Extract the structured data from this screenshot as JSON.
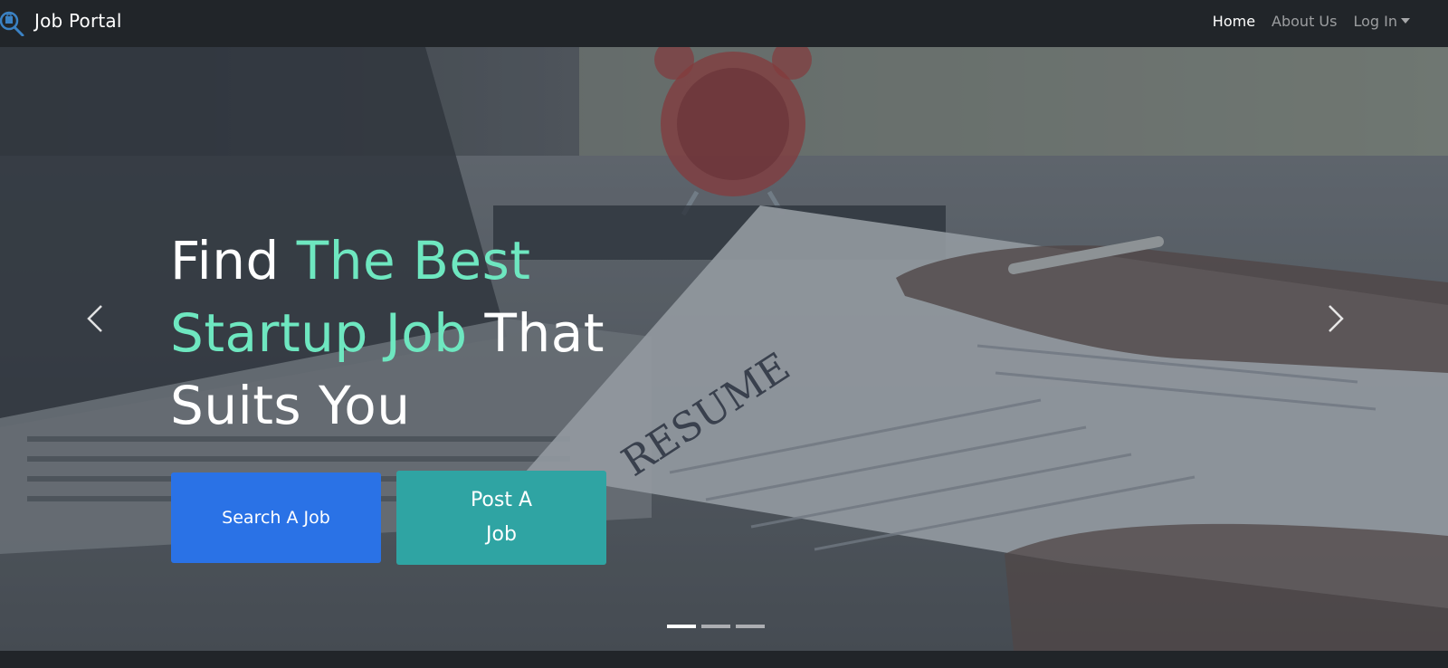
{
  "navbar": {
    "brand": "Job Portal",
    "brand_icon": "job-search-logo-icon",
    "links": [
      {
        "label": "Home",
        "active": true
      },
      {
        "label": "About Us",
        "active": false
      },
      {
        "label": "Log In",
        "active": false,
        "dropdown": true
      }
    ]
  },
  "hero": {
    "headline": {
      "part1": "Find ",
      "accent1": "The Best",
      "accent2": "Startup Job",
      "part2": " That",
      "part3": "Suits You"
    },
    "buttons": {
      "search": "Search A Job",
      "post": "Post A Job"
    },
    "background": "laptop, clock and resume on desk",
    "resume_word": "RESUME",
    "controls": {
      "prev_icon": "chevron-left-icon",
      "next_icon": "chevron-right-icon"
    },
    "slides": {
      "count": 3,
      "active_index": 0
    }
  },
  "colors": {
    "navbar_bg": "#212529",
    "accent_text": "#6ee7c0",
    "search_button": "#2a72e6",
    "post_button": "#2fa4a3"
  }
}
